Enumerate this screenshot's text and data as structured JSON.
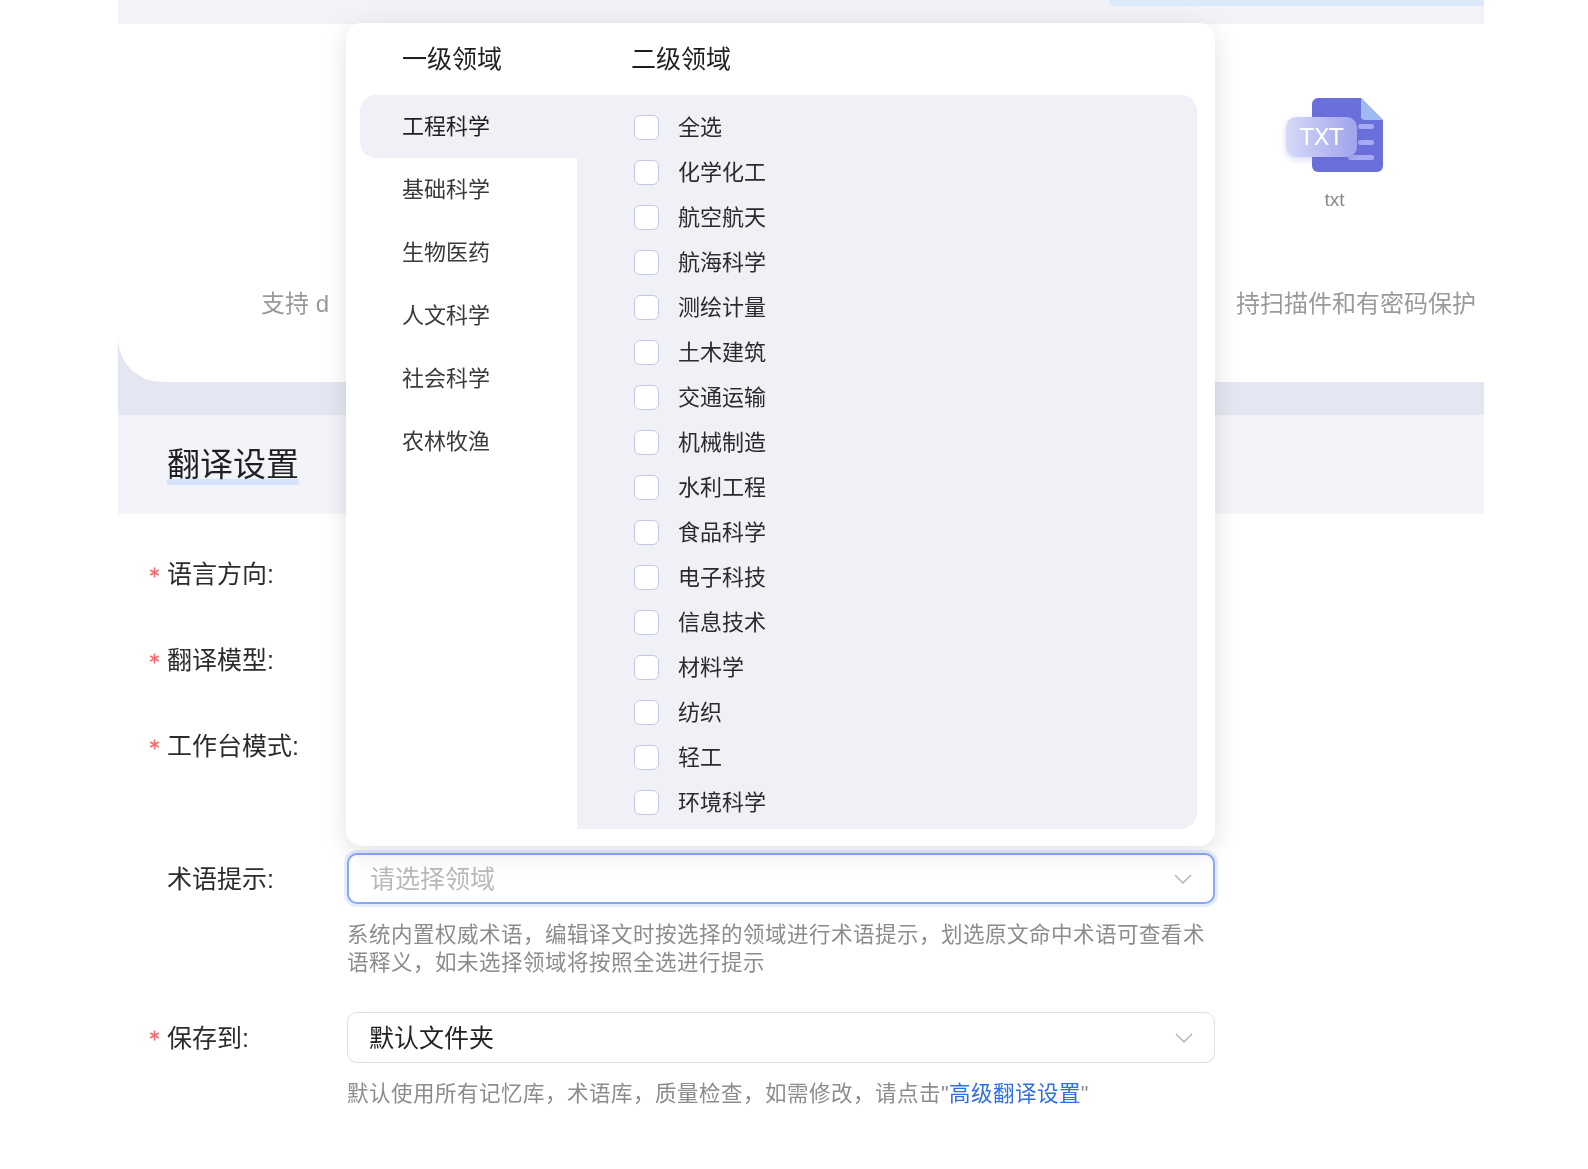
{
  "upload_card": {
    "file_types": [
      {
        "badge": "TXT",
        "label": "txt"
      }
    ],
    "support_text": [
      "支持 d",
      "持扫描件和有密码保护"
    ]
  },
  "section": {
    "title": "翻译设置"
  },
  "form": {
    "fields": [
      {
        "kind": "covered",
        "label": "语言方向:",
        "required": true
      },
      {
        "kind": "covered",
        "label": "翻译模型:",
        "required": true
      },
      {
        "kind": "covered",
        "label": "工作台模式:",
        "required": true
      },
      {
        "kind": "select",
        "label": "术语提示:",
        "required": false,
        "placeholder": "请选择领域",
        "focused": true,
        "hint": {
          "text": "系统内置权威术语，编辑译文时按选择的领域进行术语提示，划选原文命中术语可查看术语释义，如未选择领域将按照全选进行提示"
        }
      },
      {
        "kind": "select",
        "label": "保存到:",
        "required": true,
        "value": "默认文件夹",
        "focused": false,
        "hint": {
          "text": "默认使用所有记忆库，术语库，质量检查，如需修改，请点击\"",
          "link": "高级翻译设置",
          "after": "\""
        }
      }
    ]
  },
  "domain_dropdown": {
    "headers": [
      "一级领域",
      "二级领域"
    ],
    "level1": [
      {
        "label": "工程科学",
        "selected": true
      },
      {
        "label": "基础科学",
        "selected": false
      },
      {
        "label": "生物医药",
        "selected": false
      },
      {
        "label": "人文科学",
        "selected": false
      },
      {
        "label": "社会科学",
        "selected": false
      },
      {
        "label": "农林牧渔",
        "selected": false
      }
    ],
    "level2": [
      {
        "label": "全选",
        "checked": false
      },
      {
        "label": "化学化工",
        "checked": false
      },
      {
        "label": "航空航天",
        "checked": false
      },
      {
        "label": "航海科学",
        "checked": false
      },
      {
        "label": "测绘计量",
        "checked": false
      },
      {
        "label": "土木建筑",
        "checked": false
      },
      {
        "label": "交通运输",
        "checked": false
      },
      {
        "label": "机械制造",
        "checked": false
      },
      {
        "label": "水利工程",
        "checked": false
      },
      {
        "label": "食品科学",
        "checked": false
      },
      {
        "label": "电子科技",
        "checked": false
      },
      {
        "label": "信息技术",
        "checked": false
      },
      {
        "label": "材料学",
        "checked": false
      },
      {
        "label": "纺织",
        "checked": false
      },
      {
        "label": "轻工",
        "checked": false
      },
      {
        "label": "环境科学",
        "checked": false
      }
    ]
  }
}
